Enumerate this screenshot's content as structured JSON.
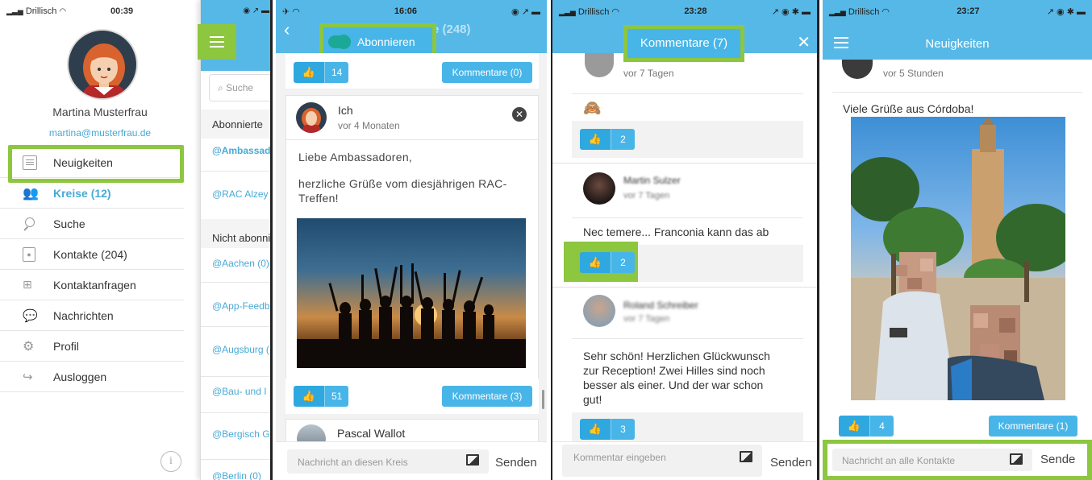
{
  "colors": {
    "accent": "#56B8E7",
    "highlight": "#8DC63F",
    "button": "#48B5E8",
    "menu_active": "#48A9D6"
  },
  "s1": {
    "status": {
      "carrier": "Drillisch",
      "time": "00:39"
    },
    "user": {
      "name": "Martina Musterfrau",
      "email": "martina@musterfrau.de"
    },
    "menu": [
      {
        "label": "Neuigkeiten",
        "icon": "news-icon"
      },
      {
        "label": "Kreise (12)",
        "icon": "circles-icon"
      },
      {
        "label": "Suche",
        "icon": "search-icon"
      },
      {
        "label": "Kontakte (204)",
        "icon": "contacts-icon"
      },
      {
        "label": "Kontaktanfragen",
        "icon": "contact-requests-icon"
      },
      {
        "label": "Nachrichten",
        "icon": "messages-icon"
      },
      {
        "label": "Profil",
        "icon": "gear-icon"
      },
      {
        "label": "Ausloggen",
        "icon": "logout-icon"
      }
    ],
    "behind": {
      "search_placeholder": "Suche",
      "abonnierte": "Abonnierte",
      "nicht_abonniert": "Nicht abonni",
      "items_top": [
        "@Ambassad",
        "@RAC Alzey"
      ],
      "items_bottom": [
        "@Aachen (0)",
        "@App-Feedb",
        "@Augsburg (",
        "@Bau- und I",
        "@Bergisch G",
        "@Berlin (0)"
      ]
    }
  },
  "s2": {
    "status": {
      "time": "16:06"
    },
    "header_title": "@Ambassadore (248)",
    "subscribe_label": "Abonnieren",
    "top_likes": "14",
    "top_comments": "Kommentare (0)",
    "post": {
      "author": "Ich",
      "time": "vor 4 Monaten",
      "line1": "Liebe Ambassadoren,",
      "line2": "herzliche Grüße vom diesjährigen RAC-Treffen!",
      "likes": "51",
      "comments": "Kommentare (3)"
    },
    "next_author": "Pascal Wallot",
    "input_placeholder": "Nachricht an diesen Kreis",
    "send": "Senden"
  },
  "s3": {
    "status": {
      "carrier": "Drillisch",
      "time": "23:28"
    },
    "header_title": "Kommentare (7)",
    "c1": {
      "time": "vor 7 Tagen",
      "emoji": "🙈",
      "likes": "2"
    },
    "c2": {
      "author": "Martin Sulzer",
      "time": "vor 7 Tagen",
      "text": "Nec temere... Franconia kann das ab",
      "likes": "2"
    },
    "c3": {
      "author": "Roland Schreiber",
      "time": "vor 7 Tagen",
      "text": "Sehr schön! Herzlichen Glückwunsch zur Reception! Zwei Hilles sind noch besser als einer. Und der war schon gut!",
      "likes": "3"
    },
    "input_placeholder": "Kommentar eingeben",
    "send": "Senden"
  },
  "s4": {
    "status": {
      "carrier": "Drillisch",
      "time": "23:27"
    },
    "header_title": "Neuigkeiten",
    "post_time": "vor 5 Stunden",
    "post_text": "Viele Grüße aus Córdoba!",
    "likes": "4",
    "comments": "Kommentare (1)",
    "input_placeholder": "Nachricht an alle Kontakte",
    "send": "Sende"
  }
}
